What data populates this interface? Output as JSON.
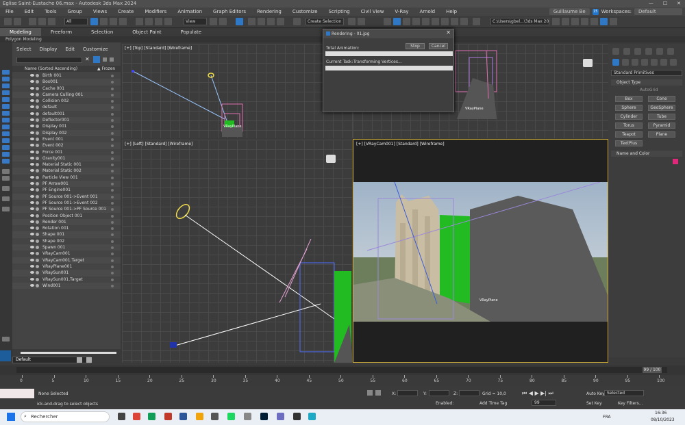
{
  "window": {
    "title": "Eglise Saint-Eustache 06.max - Autodesk 3ds Max 2024"
  },
  "menu": [
    "File",
    "Edit",
    "Tools",
    "Group",
    "Views",
    "Create",
    "Modifiers",
    "Animation",
    "Graph Editors",
    "Rendering",
    "Customize",
    "Scripting",
    "Civil View",
    "V-Ray",
    "Arnold",
    "Help"
  ],
  "account": {
    "user": "Guillaume Be",
    "badge": "15",
    "workspaces_label": "Workspaces:",
    "workspace": "Default"
  },
  "toolbar": {
    "filter": "All",
    "view": "View",
    "selection_set": "Create Selection Se",
    "path": "C:\\Users\\gbel...\\3ds Max 202"
  },
  "ribbon": {
    "tabs": [
      "Modeling",
      "Freeform",
      "Selection",
      "Object Paint",
      "Populate"
    ],
    "sub": "Polygon Modeling"
  },
  "explorer": {
    "menu": [
      "Select",
      "Display",
      "Edit",
      "Customize"
    ],
    "header_name": "Name (Sorted Ascending)",
    "header_frozen": "▲ Frozen",
    "items": [
      "Birth 001",
      "Box001",
      "Cache 001",
      "Camera Culling 001",
      "Collision 002",
      "default",
      "default001",
      "Deflector001",
      "Display 001",
      "Display 002",
      "Event 001",
      "Event 002",
      "Force 001",
      "Gravity001",
      "Material Static 001",
      "Material Static 002",
      "Particle View 001",
      "PF Arrow001",
      "PF Engine001",
      "PF Source 001->Event 001",
      "PF Source 001->Event 002",
      "PF Source 001->PF Source 001",
      "Position Object 001",
      "Render 001",
      "Rotation 001",
      "Shape 001",
      "Shape 002",
      "Spawn 001",
      "VRayCam001",
      "VRayCam001.Target",
      "VRayPlane001",
      "VRaySun001",
      "VRaySun001.Target",
      "Wind001"
    ],
    "layer": "Default"
  },
  "viewports": {
    "top": "[+] [Top] [Standard] [Wireframe]",
    "left": "[+] [Left] [Standard] [Wireframe]",
    "camera": "[+] [VRayCam001] [Standard] [Wireframe]",
    "vray_plane_label": "VRayPlane"
  },
  "render_dialog": {
    "title": "Rendering - 01.jpg",
    "stop": "Stop",
    "cancel": "Cancel",
    "total_label": "Total Animation:",
    "current_label": "Current Task:",
    "current_task": "Transforming Vertices..."
  },
  "command_panel": {
    "dropdown": "Standard Primitives",
    "section_object": "Object Type",
    "autogrid": "AutoGrid",
    "buttons": [
      "Box",
      "Cone",
      "Sphere",
      "GeoSphere",
      "Cylinder",
      "Tube",
      "Torus",
      "Pyramid",
      "Teapot",
      "Plane",
      "TextPlus"
    ],
    "section_name": "Name and Color",
    "name_color": "#e0287a"
  },
  "timeline": {
    "frame": "99 / 100",
    "ticks": [
      "0",
      "5",
      "10",
      "15",
      "20",
      "25",
      "30",
      "35",
      "40",
      "45",
      "50",
      "55",
      "60",
      "65",
      "70",
      "75",
      "80",
      "85",
      "90",
      "95",
      "100"
    ]
  },
  "status": {
    "selection": "None Selected",
    "prompt": "ick-and-drag to select objects",
    "x_label": "X:",
    "y_label": "Y:",
    "z_label": "Z:",
    "grid": "Grid = 10,0",
    "enabled": "Enabled:",
    "add_time_tag": "Add Time Tag",
    "autokey": "Auto Key",
    "setkey": "Set Key",
    "selected": "Selected",
    "key_filters": "Key Filters...",
    "current_frame": "99"
  },
  "taskbar": {
    "search": "Rechercher",
    "lang": "FRA",
    "time": "16:36",
    "date": "08/10/2023"
  }
}
